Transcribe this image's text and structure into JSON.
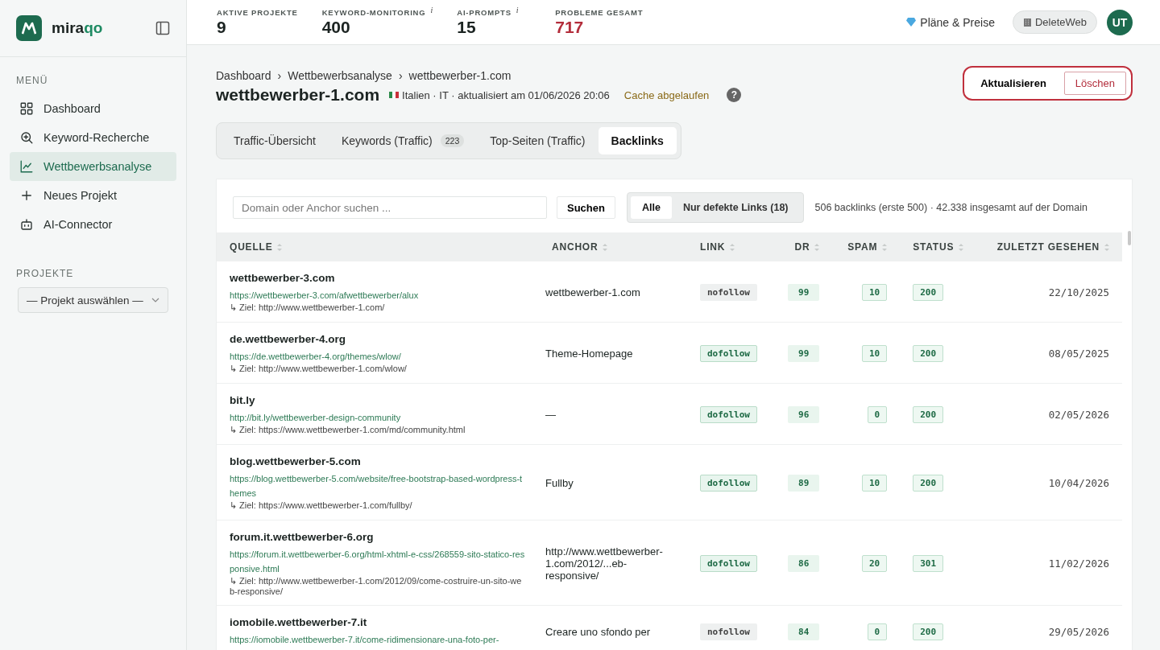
{
  "brand": {
    "name_a": "mira",
    "name_b": "qo"
  },
  "sidebar": {
    "menu_title": "MENÜ",
    "items": [
      {
        "label": "Dashboard",
        "selected": false
      },
      {
        "label": "Keyword-Recherche",
        "selected": false
      },
      {
        "label": "Wettbewerbsanalyse",
        "selected": true
      },
      {
        "label": "Neues Projekt",
        "selected": false
      },
      {
        "label": "AI-Connector",
        "selected": false
      }
    ],
    "projects_title": "PROJEKTE",
    "project_select": "— Projekt auswählen —"
  },
  "stats": [
    {
      "label": "AKTIVE PROJEKTE",
      "value": "9",
      "alert": false
    },
    {
      "label": "KEYWORD-MONITORING",
      "value": "400",
      "info": "i",
      "alert": false
    },
    {
      "label": "AI-PROMPTS",
      "value": "15",
      "info": "i",
      "alert": false
    },
    {
      "label": "PROBLEME GESAMT",
      "value": "717",
      "alert": true
    }
  ],
  "topbar": {
    "plans": "Pläne & Preise",
    "workspace": "DeleteWeb",
    "avatar": "UT"
  },
  "breadcrumb": [
    "Dashboard",
    "Wettbewerbsanalyse",
    "wettbewerber-1.com"
  ],
  "breadcrumb_sep": "›",
  "title": "wettbewerber-1.com",
  "meta": "Italien · IT · aktualisiert am 01/06/2026 20:06",
  "cache": "Cache abgelaufen",
  "help": "?",
  "actions": {
    "refresh": "Aktualisieren",
    "delete": "Löschen"
  },
  "tabs": [
    {
      "label": "Traffic-Übersicht",
      "selected": false
    },
    {
      "label": "Keywords (Traffic)",
      "count": "223",
      "selected": false
    },
    {
      "label": "Top-Seiten (Traffic)",
      "selected": false
    },
    {
      "label": "Backlinks",
      "selected": true
    }
  ],
  "search": {
    "placeholder": "Domain oder Anchor suchen ...",
    "button": "Suchen"
  },
  "filters": [
    {
      "label": "Alle",
      "selected": true
    },
    {
      "label": "Nur defekte Links (18)",
      "selected": false
    }
  ],
  "summary": "506 backlinks (erste 500) · 42.338 insgesamt auf der Domain",
  "table": {
    "columns": [
      "QUELLE",
      "ANCHOR",
      "LINK",
      "DR",
      "SPAM",
      "STATUS",
      "ZULETZT GESEHEN"
    ],
    "rows": [
      {
        "domain": "wettbewerber-3.com",
        "url": "https://wettbewerber-3.com/afwettbewerber/alux",
        "target": "↳ Ziel: http://www.wettbewerber-1.com/",
        "anchor": "wettbewerber-1.com",
        "link": "nofollow",
        "dr": "99",
        "spam": "10",
        "status": "200",
        "seen": "22/10/2025"
      },
      {
        "domain": "de.wettbewerber-4.org",
        "url": "https://de.wettbewerber-4.org/themes/wlow/",
        "target": "↳ Ziel: http://www.wettbewerber-1.com/wlow/",
        "anchor": "Theme-Homepage",
        "link": "dofollow",
        "dr": "99",
        "spam": "10",
        "status": "200",
        "seen": "08/05/2025"
      },
      {
        "domain": "bit.ly",
        "url": "http://bit.ly/wettbewerber-design-community",
        "target": "↳ Ziel: https://www.wettbewerber-1.com/md/community.html",
        "anchor": "—",
        "link": "dofollow",
        "dr": "96",
        "spam": "0",
        "status": "200",
        "seen": "02/05/2026"
      },
      {
        "domain": "blog.wettbewerber-5.com",
        "url": "https://blog.wettbewerber-5.com/website/free-bootstrap-based-wordpress-themes",
        "target": "↳ Ziel: https://www.wettbewerber-1.com/fullby/",
        "anchor": "Fullby",
        "link": "dofollow",
        "dr": "89",
        "spam": "10",
        "status": "200",
        "seen": "10/04/2026"
      },
      {
        "domain": "forum.it.wettbewerber-6.org",
        "url": "https://forum.it.wettbewerber-6.org/html-xhtml-e-css/268559-sito-statico-responsive.html",
        "target": "↳ Ziel: http://www.wettbewerber-1.com/2012/09/come-costruire-un-sito-web-responsive/",
        "anchor": "http://www.wettbewerber-1.com/2012/...eb-responsive/",
        "link": "dofollow",
        "dr": "86",
        "spam": "20",
        "status": "301",
        "seen": "11/02/2026"
      },
      {
        "domain": "iomobile.wettbewerber-7.it",
        "url": "https://iomobile.wettbewerber-7.it/come-ridimensionare-una-foto-per-",
        "anchor": "Creare uno sfondo per",
        "link": "nofollow",
        "dr": "84",
        "spam": "0",
        "status": "200",
        "seen": "29/05/2026"
      }
    ]
  }
}
